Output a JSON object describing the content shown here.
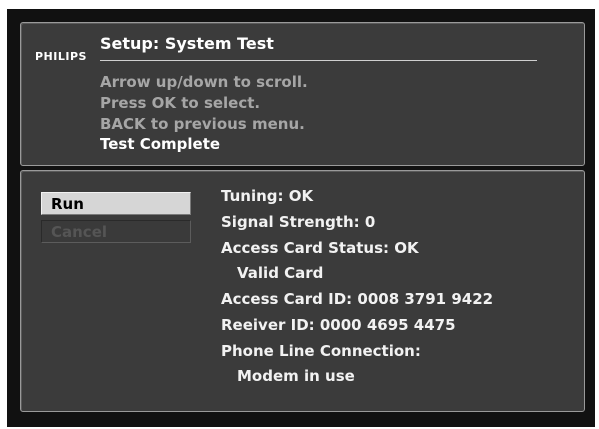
{
  "brand": "PHILIPS",
  "title": "Setup: System Test",
  "instructions": [
    "Arrow up/down to scroll.",
    "Press OK to select.",
    "BACK to previous menu."
  ],
  "status_message": "Test Complete",
  "buttons": {
    "run": "Run",
    "cancel": "Cancel"
  },
  "results": {
    "tuning": "Tuning:  OK",
    "signal_strength": "Signal Strength:  0",
    "access_card_status": "Access Card Status:  OK",
    "card_validity": "Valid Card",
    "access_card_id": "Access Card ID:  0008 3791 9422",
    "receiver_id": "Reeiver ID: 0000 4695 4475",
    "phone_line_label": "Phone Line Connection:",
    "phone_line_value": "Modem in use"
  },
  "colors": {
    "screen_background": "#111111",
    "panel_background": "#3b3b3b",
    "selected_button": "#d6d6d6",
    "disabled_text": "#555555",
    "instruction_text": "#a6a6a6"
  }
}
